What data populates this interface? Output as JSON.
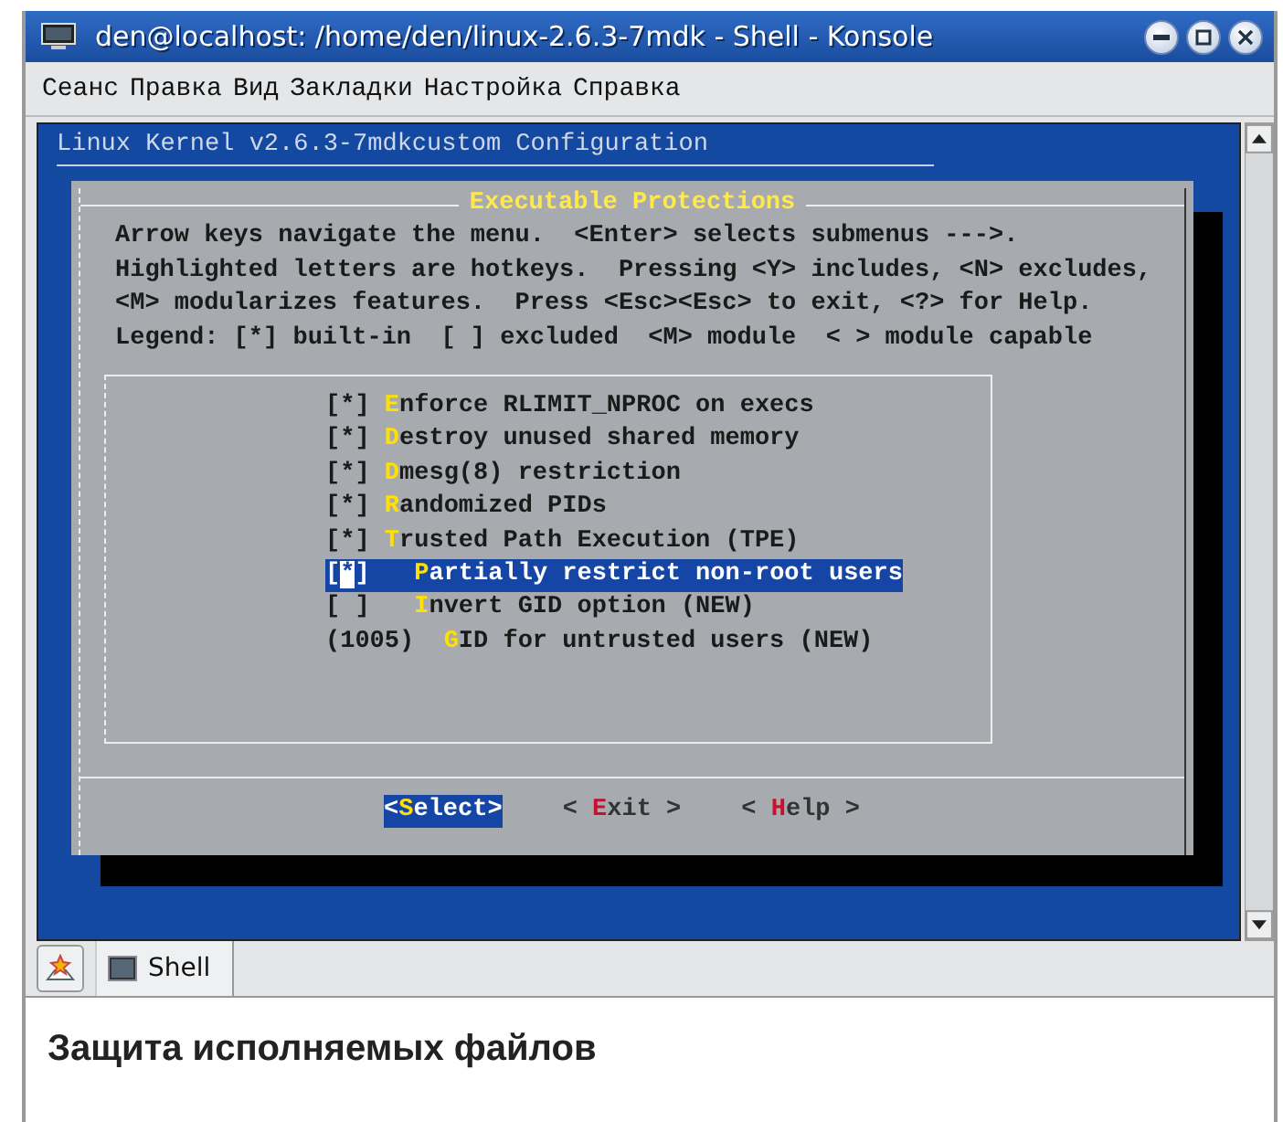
{
  "window": {
    "title": "den@localhost: /home/den/linux-2.6.3-7mdk - Shell - Konsole"
  },
  "menubar": [
    "Сеанс",
    "Правка",
    "Вид",
    "Закладки",
    "Настройка",
    "Справка"
  ],
  "terminal": {
    "header": "Linux Kernel v2.6.3-7mdkcustom Configuration",
    "dialog": {
      "title": "Executable Protections",
      "help_lines": [
        "Arrow keys navigate the menu.  <Enter> selects submenus --->.",
        "Highlighted letters are hotkeys.  Pressing <Y> includes, <N> excludes,",
        "<M> modularizes features.  Press <Esc><Esc> to exit, <?> for Help.",
        "Legend: [*] built-in  [ ] excluded  <M> module  < > module capable"
      ],
      "items": [
        {
          "text": "[*] Enforce RLIMIT_NPROC on execs",
          "selected": false
        },
        {
          "text": "[*] Destroy unused shared memory",
          "selected": false
        },
        {
          "text": "[*] Dmesg(8) restriction",
          "selected": false
        },
        {
          "text": "[*] Randomized PIDs",
          "selected": false
        },
        {
          "text": "[*] Trusted Path Execution (TPE)",
          "selected": false,
          "children": [
            {
              "text": "[*]   Partially restrict non-root users",
              "selected": true
            },
            {
              "text": "[ ]   Invert GID option (NEW)",
              "selected": false
            },
            {
              "text": "(1005)  GID for untrusted users (NEW)",
              "selected": false
            }
          ]
        }
      ],
      "buttons": [
        {
          "label": "<Select>",
          "selected": true
        },
        {
          "label": "< Exit >",
          "selected": false
        },
        {
          "label": "< Help >",
          "selected": false
        }
      ]
    }
  },
  "tabs": [
    {
      "label": "Shell",
      "selected": true
    }
  ],
  "caption": "Защита исполняемых файлов"
}
